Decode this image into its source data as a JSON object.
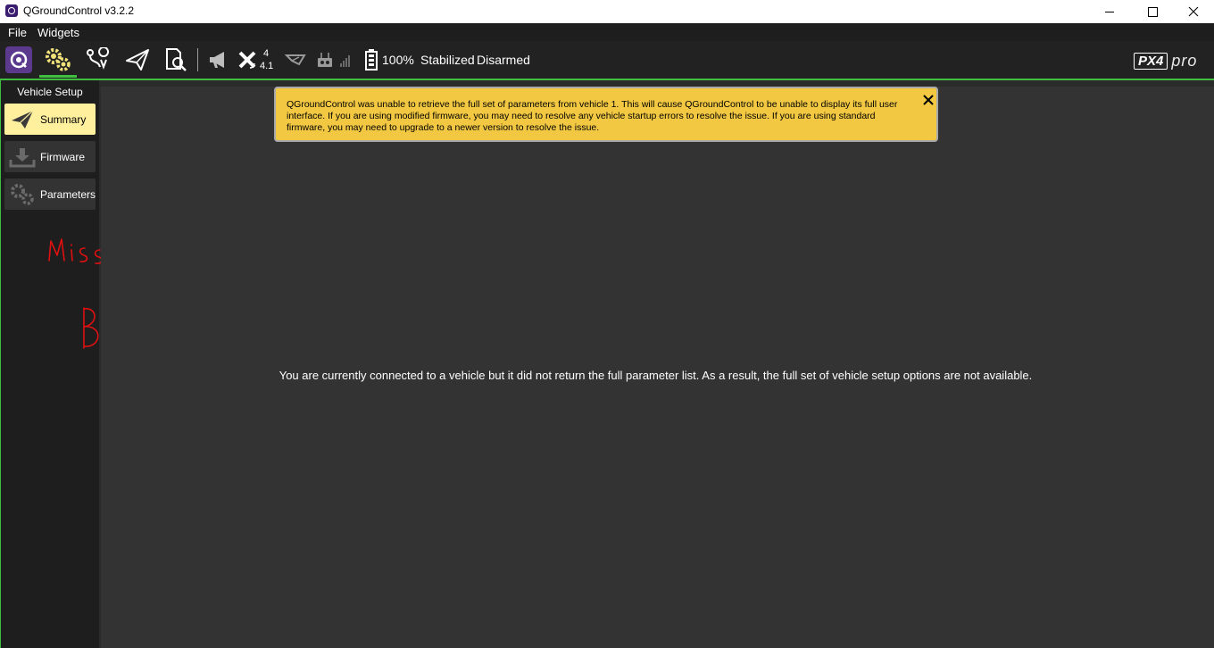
{
  "window": {
    "title": "QGroundControl v3.2.2"
  },
  "menu": {
    "items": [
      "File",
      "Widgets"
    ]
  },
  "toolbar": {
    "satellite_count": "4",
    "satellite_hdop": "4.1",
    "battery": "100%",
    "flight_mode": "Stabilized",
    "arm_state": "Disarmed",
    "logo_text": "PX4",
    "logo_suffix": "pro",
    "accent_color": "#3fbe3f"
  },
  "sidebar": {
    "heading": "Vehicle Setup",
    "items": [
      {
        "label": "Summary",
        "icon": "paper-plane-icon",
        "active": true
      },
      {
        "label": "Firmware",
        "icon": "download-icon",
        "active": false
      },
      {
        "label": "Parameters",
        "icon": "gears-icon",
        "active": false
      }
    ]
  },
  "annotation": {
    "handwritten": "Missing Buttons",
    "color": "#e01010"
  },
  "banner": {
    "message": "QGroundControl was unable to retrieve the full set of parameters from vehicle 1. This will cause QGroundControl to be unable to display its full user interface. If you are using modified firmware, you may need to resolve any vehicle startup errors to resolve the issue. If you are using standard firmware, you may need to upgrade to a newer version to resolve the issue.",
    "color": "#f2c842"
  },
  "main": {
    "message": "You are currently connected to a vehicle but it did not return the full parameter list. As a result, the full set of vehicle setup options are not available."
  }
}
